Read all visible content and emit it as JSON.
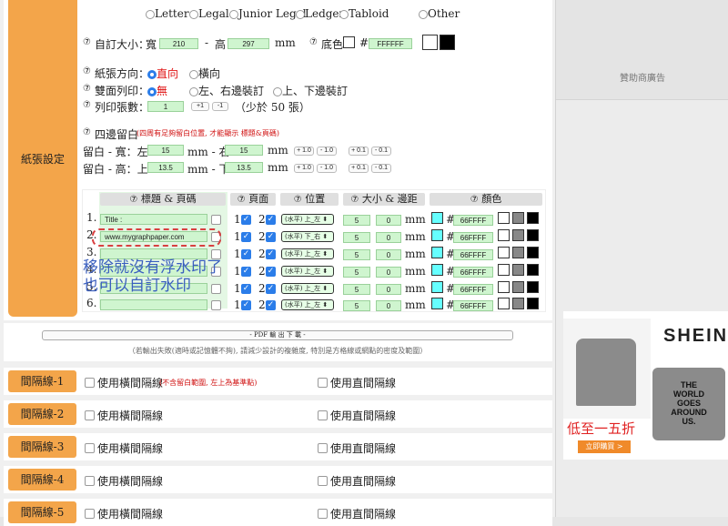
{
  "paper_sizes": [
    "Letter",
    "Legal",
    "Junior Legal",
    "Ledger",
    "Tabloid",
    "Other"
  ],
  "section_label": "紙張設定",
  "custom_size": {
    "label": "自訂大小：",
    "width_label": "寬",
    "width": "210",
    "sep": "-",
    "height_label": "高",
    "height": "297",
    "unit": "mm",
    "bg_label": "底色",
    "hash": "#",
    "bg_value": "FFFFFF"
  },
  "orientation": {
    "label": "紙張方向：",
    "opt1": "直向",
    "opt2": "橫向"
  },
  "duplex": {
    "label": "雙面列印：",
    "opt1": "無",
    "opt2": "左、右邊裝訂",
    "opt3": "上、下邊裝訂"
  },
  "copies": {
    "label": "列印張數：",
    "value": "1",
    "plus": "+1",
    "minus": "-1",
    "note": "（少於 50 張）"
  },
  "margins": {
    "label": "四邊留白",
    "note": "(四周有足夠留白位置, 才能顯示 標題&頁碼)",
    "lr_label": "留白 - 寬：左",
    "lr_mid": "mm - 右",
    "ud_label": "留白 - 高：上",
    "ud_mid": "mm - 下",
    "mm": "mm",
    "left": "15",
    "right": "15",
    "top": "13.5",
    "bottom": "13.5",
    "b1": "+ 1.0",
    "b2": "- 1.0",
    "b3": "+ 0.1",
    "b4": "- 0.1"
  },
  "table": {
    "h_title": "標題 & 頁碼",
    "h_page": "頁面",
    "h_pos": "位置",
    "h_size": "大小 & 邊距",
    "h_color": "顏色",
    "rows": [
      {
        "num": "1.",
        "text": "Title :",
        "p1": "1",
        "p2": "2",
        "pos": "(水平) 上_左",
        "size": "5",
        "margin": "0",
        "mm": "mm",
        "hash": "#",
        "color": "66FFFF"
      },
      {
        "num": "2.",
        "text": "www.mygraphpaper.com",
        "p1": "1",
        "p2": "2",
        "pos": "(水平) 下_右",
        "size": "5",
        "margin": "0",
        "mm": "mm",
        "hash": "#",
        "color": "66FFFF"
      },
      {
        "num": "3.",
        "text": "",
        "p1": "1",
        "p2": "2",
        "pos": "(水平) 上_左",
        "size": "5",
        "margin": "0",
        "mm": "mm",
        "hash": "#",
        "color": "66FFFF"
      },
      {
        "num": "4.",
        "text": "",
        "p1": "1",
        "p2": "2",
        "pos": "(水平) 上_左",
        "size": "5",
        "margin": "0",
        "mm": "mm",
        "hash": "#",
        "color": "66FFFF"
      },
      {
        "num": "5.",
        "text": "",
        "p1": "1",
        "p2": "2",
        "pos": "(水平) 上_左",
        "size": "5",
        "margin": "0",
        "mm": "mm",
        "hash": "#",
        "color": "66FFFF"
      },
      {
        "num": "6.",
        "text": "",
        "p1": "1",
        "p2": "2",
        "pos": "(水平) 上_左",
        "size": "5",
        "margin": "0",
        "mm": "mm",
        "hash": "#",
        "color": "66FFFF"
      }
    ]
  },
  "annotation": {
    "line1": "移除就沒有浮水印了",
    "line2": "也可以自訂水印"
  },
  "pdf": {
    "button": "- PDF 輸 出 下 載 -",
    "note": "（若輸出失敗(適時或記憶體不夠), 請減少設計的複雜度, 特別是方格線或網點的密度及範圍）"
  },
  "lines": [
    {
      "btn": "間隔線-1",
      "h": "使用橫間隔線",
      "note": "(不含留白範圍, 左上為基準點)",
      "v": "使用直間隔線"
    },
    {
      "btn": "間隔線-2",
      "h": "使用橫間隔線",
      "note": "",
      "v": "使用直間隔線"
    },
    {
      "btn": "間隔線-3",
      "h": "使用橫間隔線",
      "note": "",
      "v": "使用直間隔線"
    },
    {
      "btn": "間隔線-4",
      "h": "使用橫間隔線",
      "note": "",
      "v": "使用直間隔線"
    },
    {
      "btn": "間隔線-5",
      "h": "使用橫間隔線",
      "note": "",
      "v": "使用直間隔線"
    }
  ],
  "sponsor": "贊助商廣告",
  "ad": {
    "brand": "SHEIN",
    "shirt_text": "THE WORLD GOES AROUND US.",
    "promo": "低至一五折",
    "cta": "立即購買 >"
  },
  "colors": {
    "accent": "#f3a54a",
    "input": "#cff5cf",
    "cyan": "#66ffff",
    "blue": "#2b7de9"
  }
}
